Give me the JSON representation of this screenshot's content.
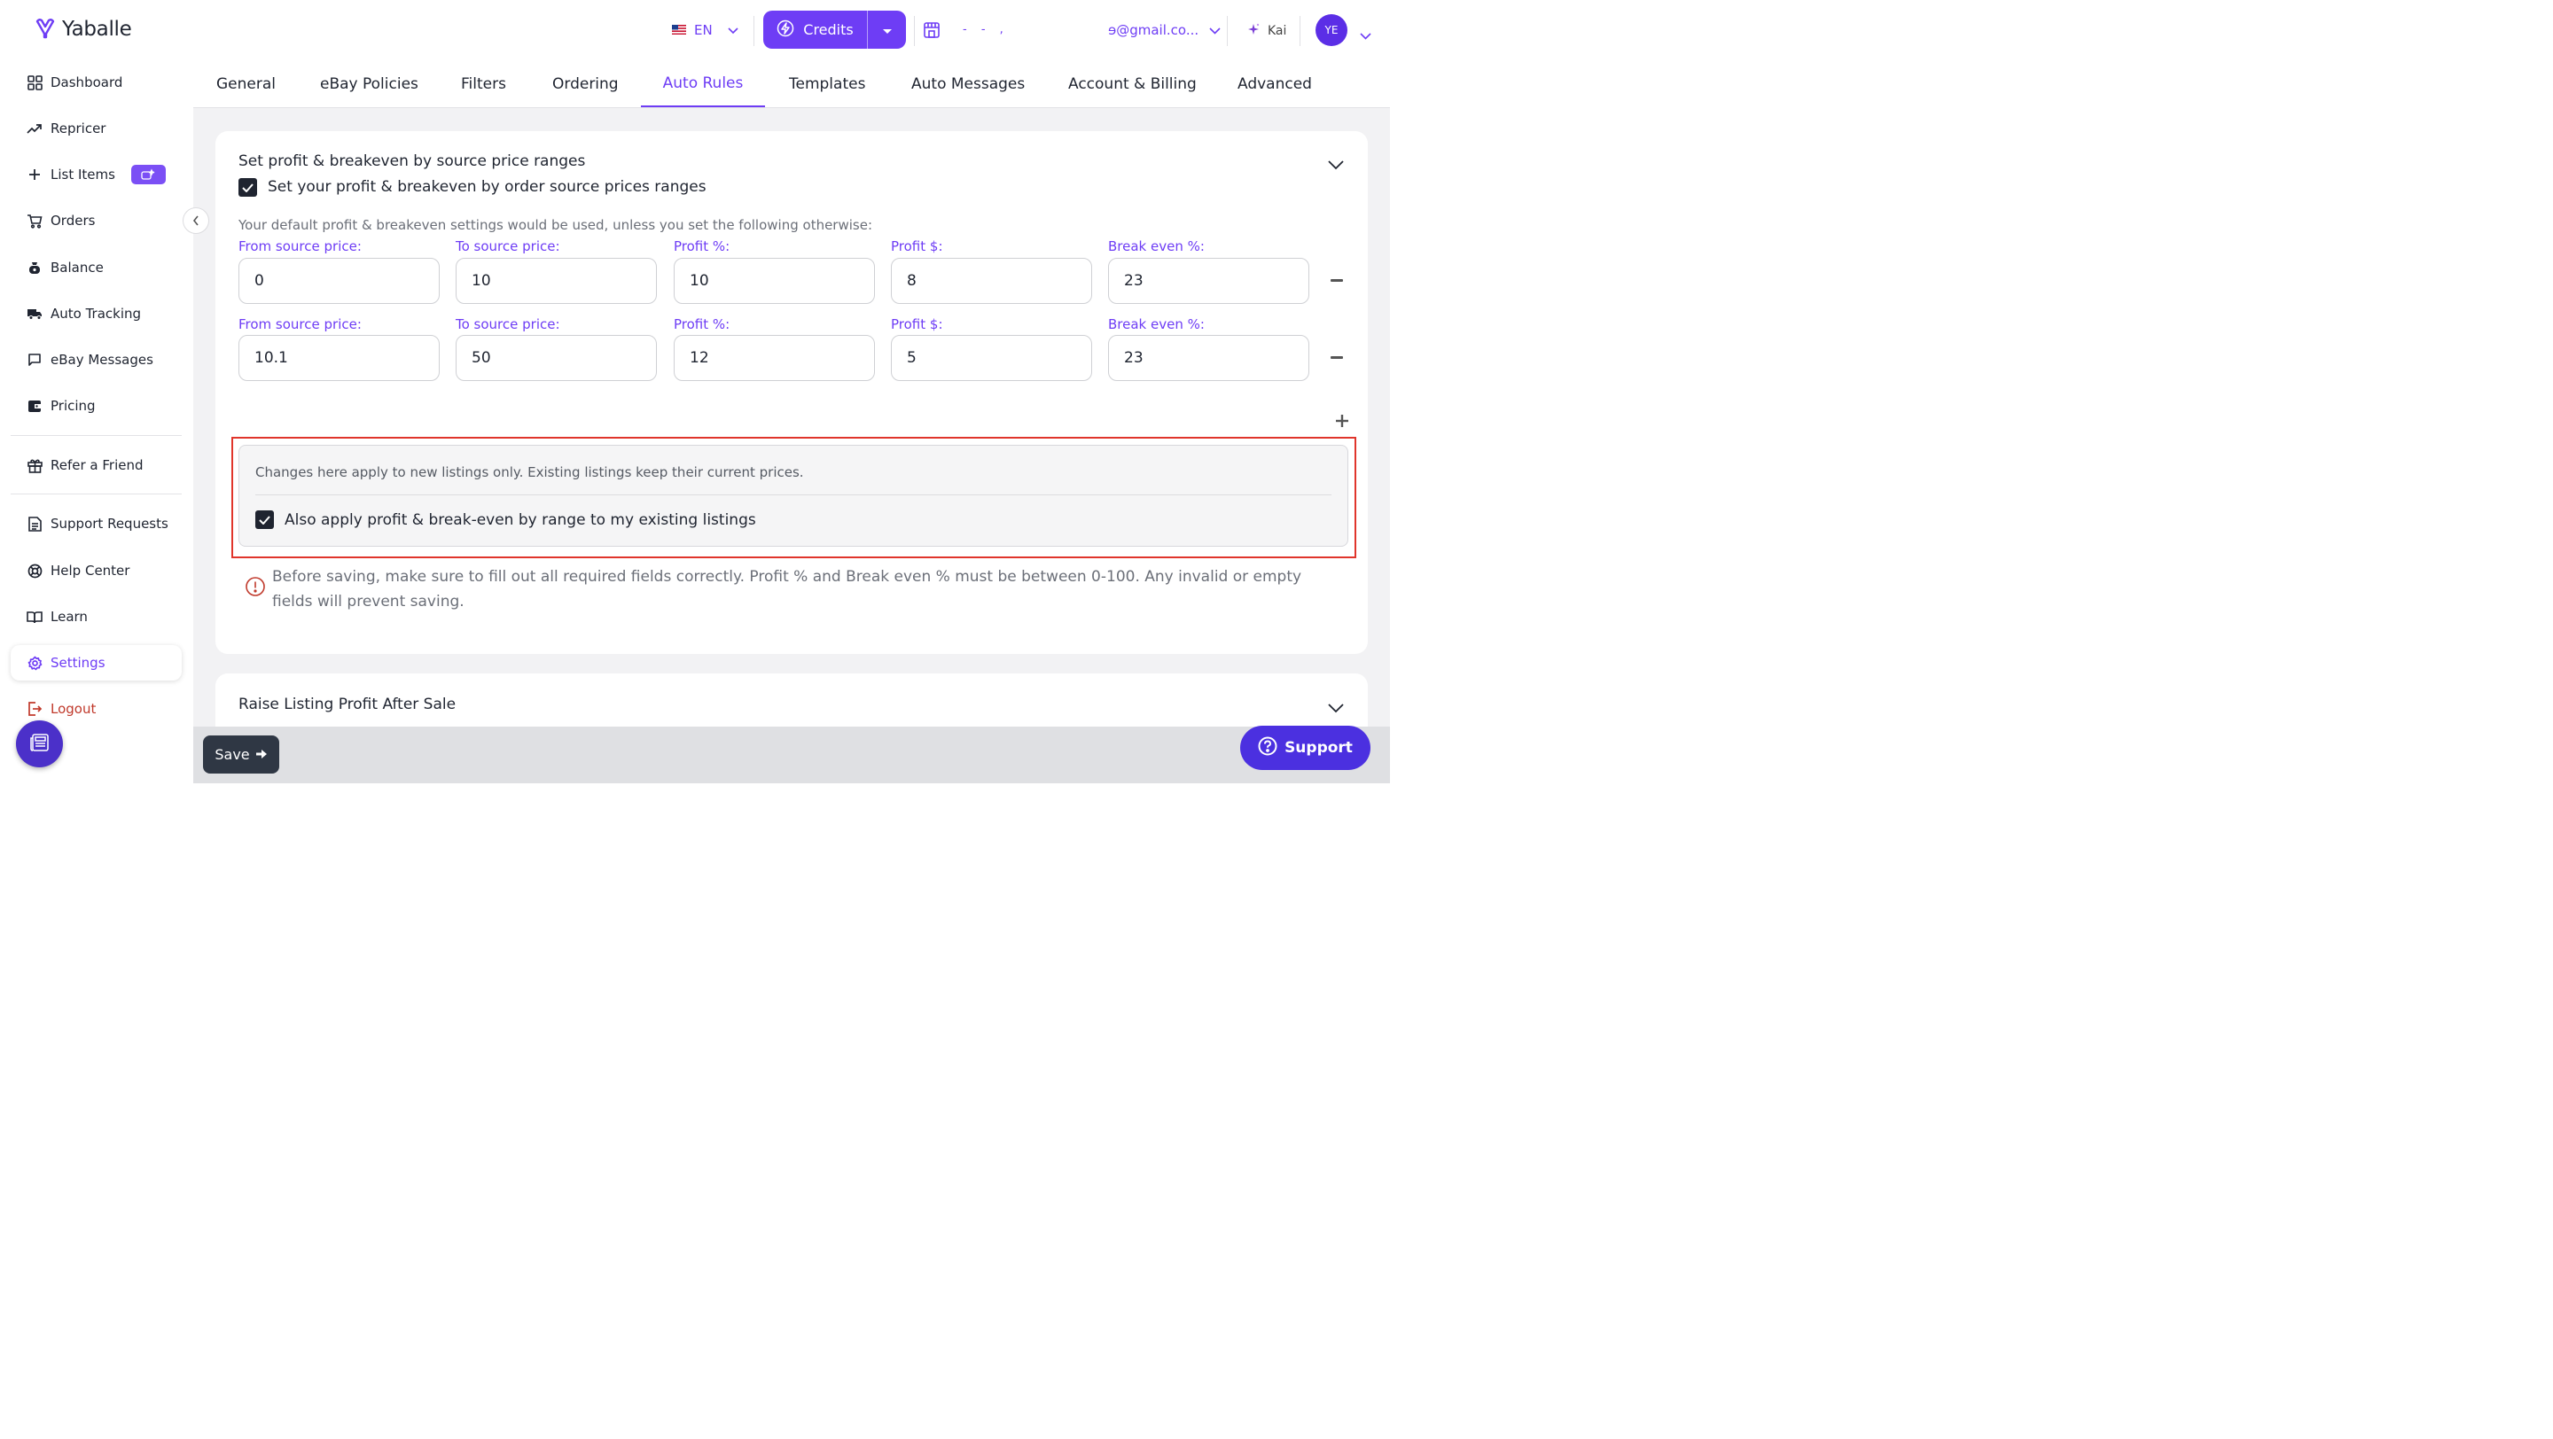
{
  "brand": {
    "name": "Yaballe"
  },
  "sidebar": {
    "items": [
      {
        "label": "Dashboard"
      },
      {
        "label": "Repricer"
      },
      {
        "label": "List Items"
      },
      {
        "label": "Orders"
      },
      {
        "label": "Balance"
      },
      {
        "label": "Auto Tracking"
      },
      {
        "label": "eBay Messages"
      },
      {
        "label": "Pricing"
      },
      {
        "label": "Refer a Friend"
      },
      {
        "label": "Support Requests"
      },
      {
        "label": "Help Center"
      },
      {
        "label": "Learn"
      },
      {
        "label": "Settings"
      },
      {
        "label": "Logout"
      }
    ]
  },
  "header": {
    "language": "EN",
    "credits_label": "Credits",
    "email": "ɘ@gmail.co...",
    "ai_label": "Kai",
    "avatar_initials": "YE",
    "obscured_text": "- - ,"
  },
  "tabs": [
    {
      "label": "General"
    },
    {
      "label": "eBay Policies"
    },
    {
      "label": "Filters"
    },
    {
      "label": "Ordering"
    },
    {
      "label": "Auto Rules"
    },
    {
      "label": "Templates"
    },
    {
      "label": "Auto Messages"
    },
    {
      "label": "Account & Billing"
    },
    {
      "label": "Advanced"
    }
  ],
  "section": {
    "title": "Set profit & breakeven by source price ranges",
    "checkbox_label": "Set your profit & breakeven by order source prices ranges",
    "description": "Your default profit & breakeven settings would be used, unless you set the following otherwise:",
    "field_labels": {
      "from": "From source price:",
      "to": "To source price:",
      "profit_pct": "Profit %:",
      "profit_usd": "Profit $:",
      "break_even": "Break even %:"
    },
    "rows": [
      {
        "from": "0",
        "to": "10",
        "profit_pct": "10",
        "profit_usd": "8",
        "break_even": "23"
      },
      {
        "from": "10.1",
        "to": "50",
        "profit_pct": "12",
        "profit_usd": "5",
        "break_even": "23"
      }
    ],
    "notice_text": "Changes here apply to new listings only. Existing listings keep their current prices.",
    "apply_existing_label": "Also apply profit & break-even by range to my existing listings",
    "warning_text": "Before saving, make sure to fill out all required fields correctly. Profit % and Break even % must be between 0-100. Any invalid or empty fields will prevent saving."
  },
  "section2": {
    "title": "Raise Listing Profit After Sale"
  },
  "footer": {
    "save_label": "Save",
    "support_label": "Support"
  },
  "colors": {
    "accent": "#6e3df5",
    "brand_dark": "#4b30c9",
    "alert": "#e0352b"
  }
}
